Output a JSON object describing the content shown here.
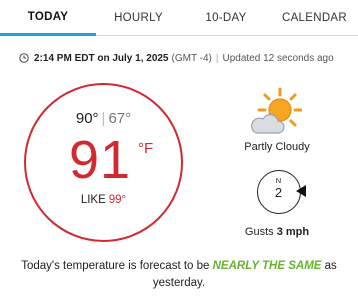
{
  "tabs": [
    {
      "label": "TODAY"
    },
    {
      "label": "HOURLY"
    },
    {
      "label": "10-DAY"
    },
    {
      "label": "CALENDAR"
    }
  ],
  "meta": {
    "time": "2:14 PM EDT on July 1, 2025",
    "gmt": "(GMT -4)",
    "separator": "|",
    "updated": "Updated 12 seconds ago"
  },
  "temps": {
    "high": "90°",
    "divider": "|",
    "low": "67°",
    "current": "91",
    "unit": "°F",
    "feels_label": "LIKE",
    "feels_value": "99°"
  },
  "condition": {
    "label": "Partly Cloudy",
    "icon": "partly-cloudy-icon"
  },
  "wind": {
    "direction": "N",
    "speed": "2",
    "gusts_label": "Gusts",
    "gusts_value": "3 mph",
    "icon": "wind-direction-arrow-icon"
  },
  "forecast": {
    "before": "Today's temperature is forecast to be ",
    "highlight": "NEARLY THE SAME",
    "after": " as yesterday."
  },
  "colors": {
    "accent": "#1aa3dc",
    "temp": "#d0292f",
    "highlight": "#65b32e"
  }
}
